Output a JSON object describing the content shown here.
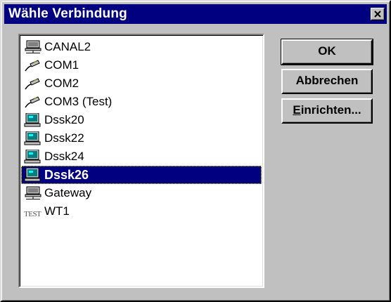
{
  "window": {
    "title": "Wähle Verbindung"
  },
  "connections": [
    {
      "label": "CANAL2",
      "icon": "network-computer-icon"
    },
    {
      "label": "COM1",
      "icon": "serial-cable-icon"
    },
    {
      "label": "COM2",
      "icon": "serial-cable-icon"
    },
    {
      "label": "COM3 (Test)",
      "icon": "serial-cable-icon"
    },
    {
      "label": "Dssk20",
      "icon": "workstation-icon"
    },
    {
      "label": "Dssk22",
      "icon": "workstation-icon"
    },
    {
      "label": "Dssk24",
      "icon": "workstation-icon"
    },
    {
      "label": "Dssk26",
      "icon": "workstation-icon",
      "selected": true
    },
    {
      "label": "Gateway",
      "icon": "network-computer-icon"
    },
    {
      "label": "WT1",
      "icon": "test-icon",
      "icon_text": "TEST"
    }
  ],
  "buttons": {
    "ok": "OK",
    "cancel": "Abbrechen",
    "setup_first": "E",
    "setup_rest": "inrichten..."
  },
  "colors": {
    "titlebar": "#000080",
    "selection": "#000080",
    "face": "#c0c0c0"
  }
}
